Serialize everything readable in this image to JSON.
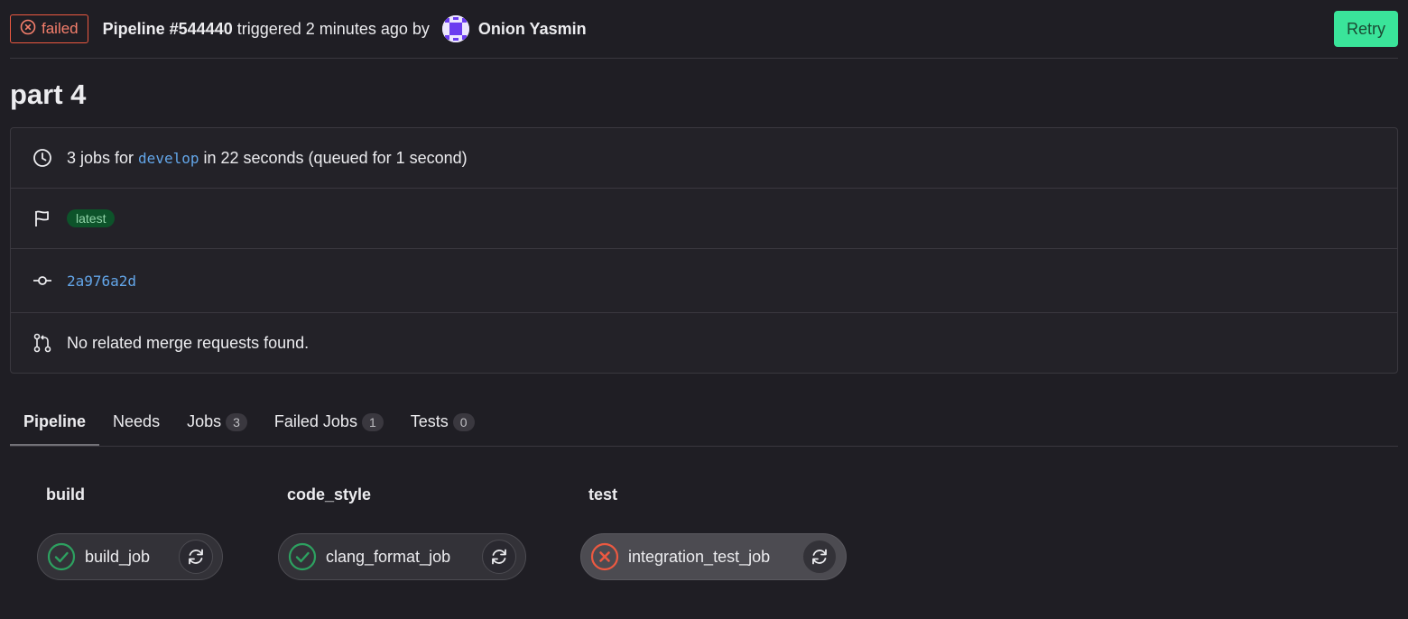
{
  "header": {
    "status": "failed",
    "pipeline_id": "Pipeline #544440",
    "triggered_text": "triggered 2 minutes ago by",
    "author": "Onion Yasmin",
    "retry_label": "Retry"
  },
  "title": "part 4",
  "info": {
    "jobs_prefix": "3 jobs for",
    "branch": "develop",
    "jobs_suffix": "in 22 seconds (queued for 1 second)",
    "tag": "latest",
    "commit": "2a976a2d",
    "merge_requests": "No related merge requests found."
  },
  "tabs": [
    {
      "label": "Pipeline",
      "count": null
    },
    {
      "label": "Needs",
      "count": null
    },
    {
      "label": "Jobs",
      "count": "3"
    },
    {
      "label": "Failed Jobs",
      "count": "1"
    },
    {
      "label": "Tests",
      "count": "0"
    }
  ],
  "stages": [
    {
      "name": "build",
      "job": "build_job",
      "status": "success"
    },
    {
      "name": "code_style",
      "job": "clang_format_job",
      "status": "success"
    },
    {
      "name": "test",
      "job": "integration_test_job",
      "status": "failed"
    }
  ],
  "colors": {
    "failed": "#ec5941",
    "success": "#2da160",
    "link": "#63a6e9",
    "retry_button": "#3ae49a"
  }
}
